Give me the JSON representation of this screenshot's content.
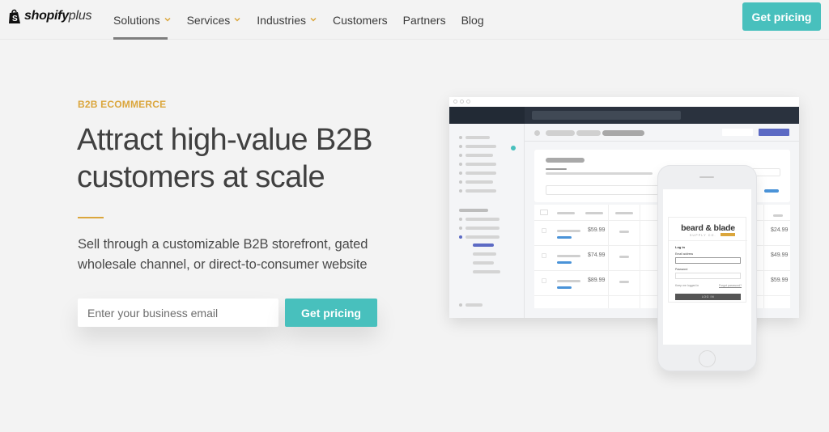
{
  "nav": {
    "logo_word": "shopify",
    "logo_plus": "plus",
    "items": [
      {
        "label": "Solutions",
        "has_dropdown": true,
        "active": true
      },
      {
        "label": "Services",
        "has_dropdown": true,
        "active": false
      },
      {
        "label": "Industries",
        "has_dropdown": true,
        "active": false
      },
      {
        "label": "Customers",
        "has_dropdown": false,
        "active": false
      },
      {
        "label": "Partners",
        "has_dropdown": false,
        "active": false
      },
      {
        "label": "Blog",
        "has_dropdown": false,
        "active": false
      }
    ],
    "cta_label": "Get pricing"
  },
  "hero": {
    "eyebrow": "B2B ECOMMERCE",
    "headline": "Attract high-value B2B customers at scale",
    "subtext": "Sell through a customizable B2B storefront, gated wholesale channel, or direct-to-consumer website",
    "email_placeholder": "Enter your business email",
    "email_value": "",
    "cta_label": "Get pricing"
  },
  "mockup": {
    "table_prices_left": [
      "$59.99",
      "$74.99",
      "$89.99"
    ],
    "table_prices_right": [
      "$24.99",
      "$49.99",
      "$59.99"
    ],
    "phone": {
      "brand": "beard & blade",
      "brand_sub": "SUPPLY CO.",
      "login_title": "Log in",
      "email_label": "Email address",
      "password_label": "Password",
      "remember_label": "Keep me logged in",
      "forgot_label": "Forgot password?",
      "login_button": "LOG IN"
    }
  },
  "colors": {
    "accent_teal": "#48c0bd",
    "accent_gold": "#dba63c",
    "admin_dark": "#2a323e",
    "admin_purple": "#5c6ac4",
    "link_blue": "#4a93d8"
  }
}
